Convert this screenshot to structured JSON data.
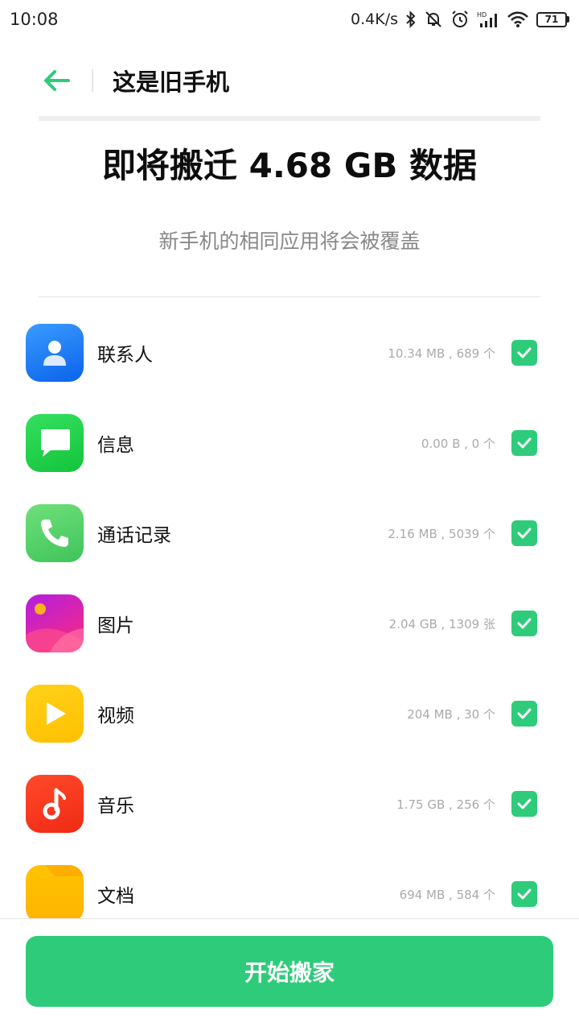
{
  "status_bar": {
    "time": "10:08",
    "speed": "0.4K/s",
    "battery": "71"
  },
  "header": {
    "title": "这是旧手机"
  },
  "summary": {
    "title": "即将搬迁 4.68 GB 数据",
    "subtitle": "新手机的相同应用将会被覆盖"
  },
  "items": [
    {
      "label": "联系人",
      "meta": "10.34 MB , 689 个",
      "icon": "contacts-icon",
      "checked": true
    },
    {
      "label": "信息",
      "meta": "0.00 B , 0 个",
      "icon": "messages-icon",
      "checked": true
    },
    {
      "label": "通话记录",
      "meta": "2.16 MB , 5039 个",
      "icon": "phone-icon",
      "checked": true
    },
    {
      "label": "图片",
      "meta": "2.04 GB , 1309 张",
      "icon": "gallery-icon",
      "checked": true
    },
    {
      "label": "视频",
      "meta": "204 MB , 30 个",
      "icon": "video-play-icon",
      "checked": true
    },
    {
      "label": "音乐",
      "meta": "1.75 GB , 256 个",
      "icon": "music-note-icon",
      "checked": true
    },
    {
      "label": "文档",
      "meta": "694 MB , 584 个",
      "icon": "folder-icon",
      "checked": true
    }
  ],
  "button": {
    "start_label": "开始搬家"
  },
  "colors": {
    "accent": "#2ecc7a"
  }
}
